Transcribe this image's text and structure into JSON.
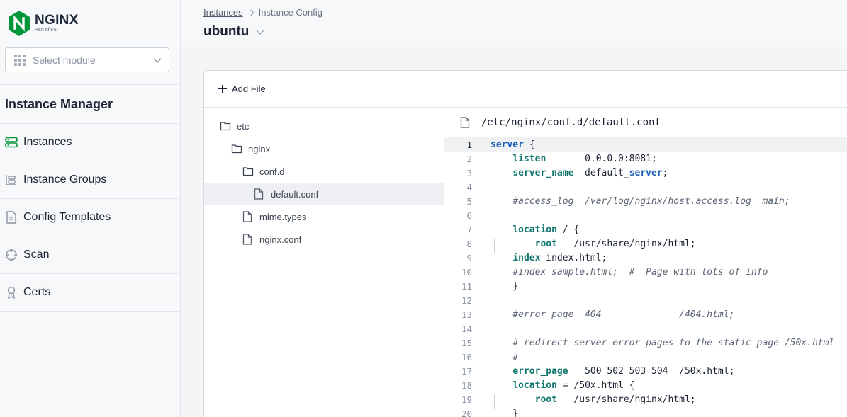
{
  "app": {
    "logo_name": "NGINX",
    "logo_sub": "Part of F5",
    "module_placeholder": "Select module"
  },
  "sidebar": {
    "section_title": "Instance Manager",
    "items": [
      {
        "label": "Instances",
        "icon": "server-icon",
        "active": true
      },
      {
        "label": "Instance Groups",
        "icon": "groups-icon",
        "active": false
      },
      {
        "label": "Config Templates",
        "icon": "template-icon",
        "active": false
      },
      {
        "label": "Scan",
        "icon": "scan-icon",
        "active": false
      },
      {
        "label": "Certs",
        "icon": "certificate-icon",
        "active": false
      }
    ]
  },
  "header": {
    "breadcrumb": [
      "Instances",
      "Instance Config"
    ],
    "title": "ubuntu"
  },
  "toolbar": {
    "add_file_label": "Add File"
  },
  "tree": [
    {
      "name": "etc",
      "type": "folder",
      "depth": 0
    },
    {
      "name": "nginx",
      "type": "folder",
      "depth": 1
    },
    {
      "name": "conf.d",
      "type": "folder",
      "depth": 2
    },
    {
      "name": "default.conf",
      "type": "file",
      "depth": 3,
      "selected": true
    },
    {
      "name": "mime.types",
      "type": "file",
      "depth": 2
    },
    {
      "name": "nginx.conf",
      "type": "file",
      "depth": 2
    }
  ],
  "editor": {
    "file_path": "/etc/nginx/conf.d/default.conf",
    "active_line": 1,
    "lines": [
      "server {",
      "    listen       0.0.0.0:8081;",
      "    server_name  default_server;",
      "",
      "    #access_log  /var/log/nginx/host.access.log  main;",
      "",
      "    location / {",
      "        root   /usr/share/nginx/html;",
      "    index index.html;",
      "    #index sample.html;  #  Page with lots of info",
      "    }",
      "",
      "    #error_page  404              /404.html;",
      "",
      "    # redirect server error pages to the static page /50x.html",
      "    #",
      "    error_page   500 502 503 504  /50x.html;",
      "    location = /50x.html {",
      "        root   /usr/share/nginx/html;",
      "    }"
    ]
  },
  "colors": {
    "brand": "#009639",
    "keyword": "#0f766e",
    "keyword_alt": "#1d5fb8"
  }
}
